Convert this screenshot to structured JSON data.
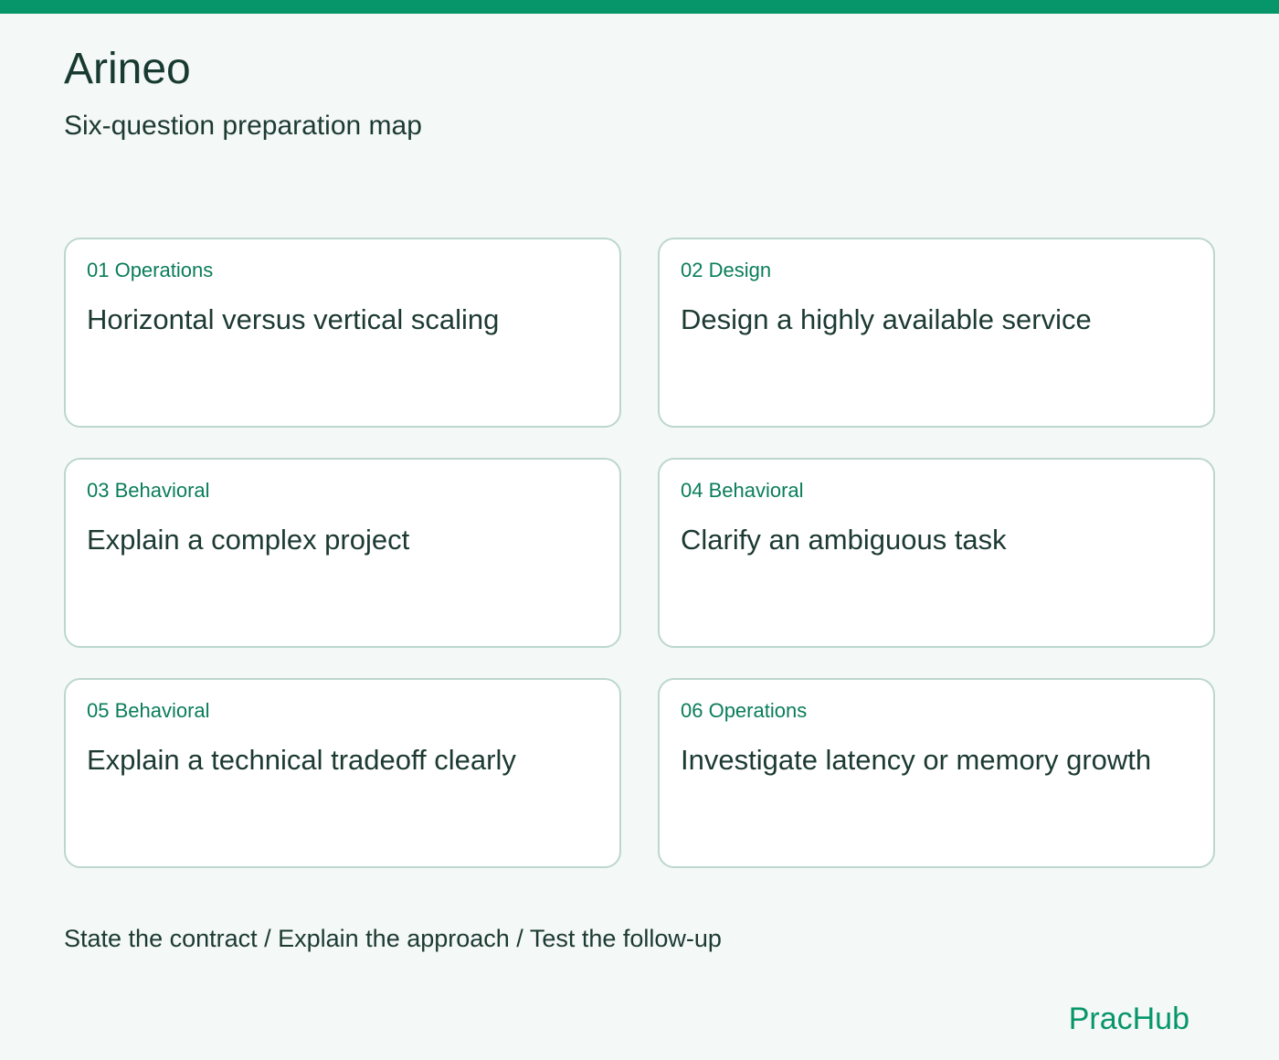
{
  "header": {
    "title": "Arineo",
    "subtitle": "Six-question preparation map"
  },
  "cards": [
    {
      "tag": "01 Operations",
      "title": "Horizontal versus vertical scaling"
    },
    {
      "tag": "02 Design",
      "title": "Design a highly available service"
    },
    {
      "tag": "03 Behavioral",
      "title": "Explain a complex project"
    },
    {
      "tag": "04 Behavioral",
      "title": "Clarify an ambiguous task"
    },
    {
      "tag": "05 Behavioral",
      "title": "Explain a technical tradeoff clearly"
    },
    {
      "tag": "06 Operations",
      "title": "Investigate latency or memory growth"
    }
  ],
  "footer": {
    "note": "State the contract / Explain the approach / Test the follow-up",
    "brand": "PracHub"
  },
  "colors": {
    "accent": "#07966a",
    "tag_text": "#0a7d5a",
    "card_border": "#bcd7cd",
    "background": "#f4f8f6"
  }
}
